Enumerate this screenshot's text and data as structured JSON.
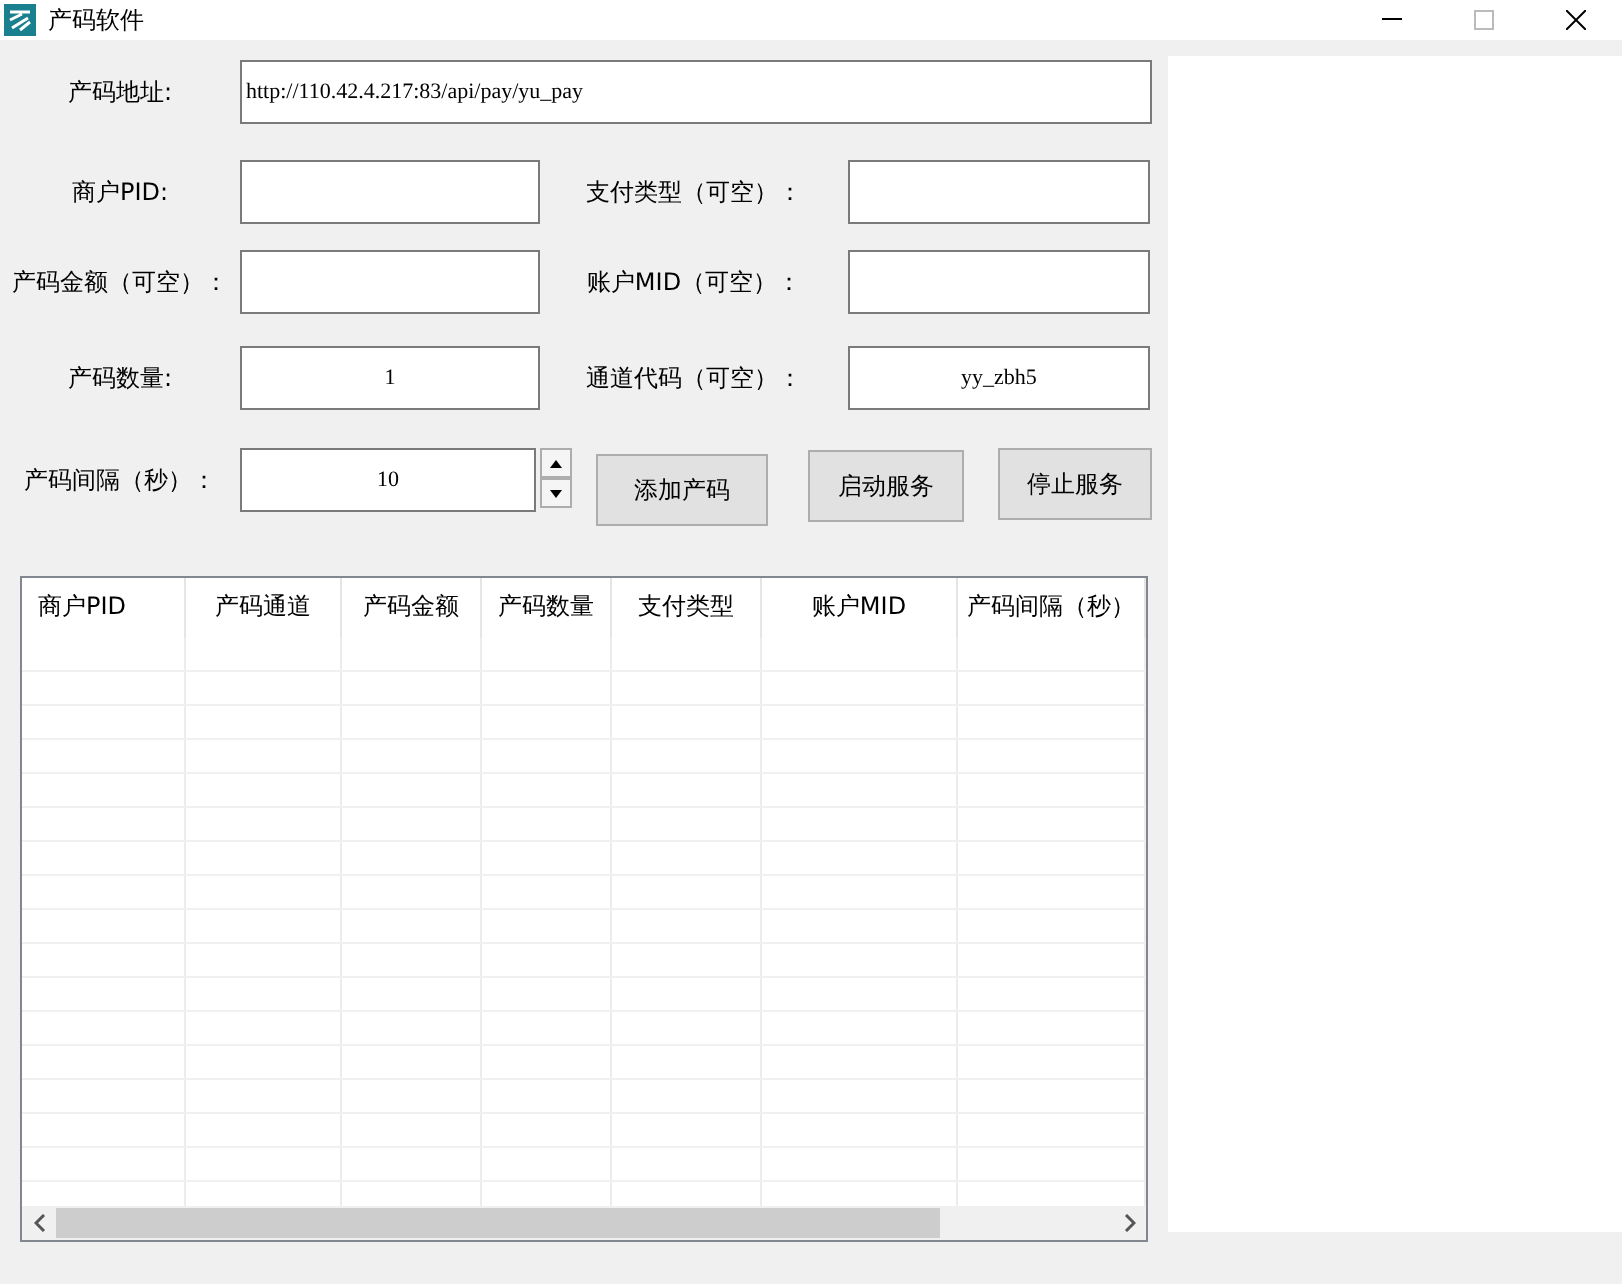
{
  "window": {
    "title": "产码软件"
  },
  "url_field": {
    "label": "产码地址:",
    "value": "http://110.42.4.217:83/api/pay/yu_pay"
  },
  "field_rows": [
    [
      {
        "label": "商户PID:"
      },
      {
        "label": "支付类型（可空）："
      }
    ],
    [
      {
        "label": "产码金额（可空）："
      },
      {
        "label": "账户MID（可空）："
      }
    ],
    [
      {
        "label": "产码数量:",
        "value": "1"
      },
      {
        "label": "通道代码（可空）：",
        "value": "yy_zbh5"
      }
    ]
  ],
  "interval": {
    "label": "产码间隔（秒）：",
    "value": "10"
  },
  "buttons": [
    "添加产码",
    "启动服务",
    "停止服务"
  ],
  "table": {
    "columns": [
      "商户PID",
      "产码通道",
      "产码金额",
      "产码数量",
      "支付类型",
      "账户MID",
      "产码间隔（秒）"
    ]
  }
}
